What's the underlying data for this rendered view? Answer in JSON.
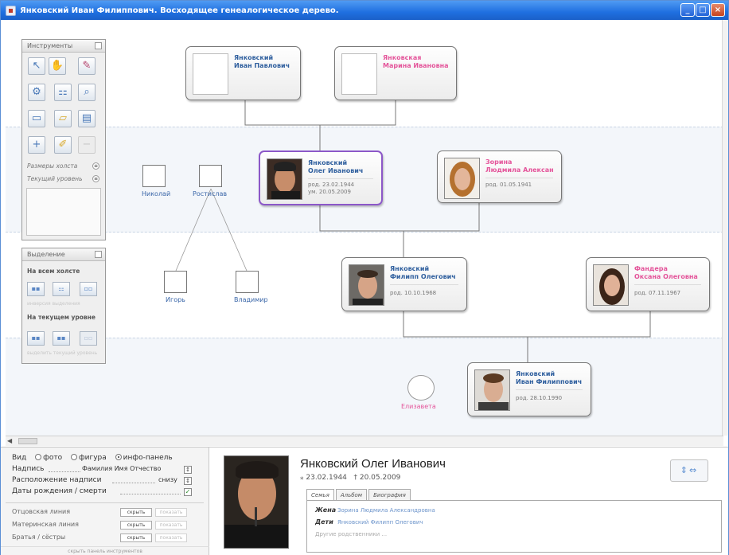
{
  "window": {
    "title": "Янковский Иван Филиппович. Восходящее генеалогическое дерево."
  },
  "tree": {
    "grandparents": [
      {
        "name1": "Янковский",
        "name2": "Иван Павлович",
        "gender": "m"
      },
      {
        "name1": "Янковская",
        "name2": "Марина Ивановна",
        "gender": "f"
      }
    ],
    "oleg": {
      "name1": "Янковский",
      "name2": "Олег Иванович",
      "birth": "род.  23.02.1944",
      "death": "ум.  20.05.2009"
    },
    "lyudmila": {
      "name1": "Зорина",
      "name2": "Людмила Алексан",
      "birth": "род.  01.05.1941"
    },
    "filipp": {
      "name1": "Янковский",
      "name2": "Филипп Олегович",
      "birth": "род.  10.10.1968"
    },
    "oksana": {
      "name1": "Фандера",
      "name2": "Оксана Олеговна",
      "birth": "род.  07.11.1967"
    },
    "ivan": {
      "name1": "Янковский",
      "name2": "Иван Филиппович",
      "birth": "род.  28.10.1990"
    },
    "small": {
      "nikolai": "Николай",
      "rostislav": "Ростислав",
      "igor": "Игорь",
      "vladimir": "Владимир",
      "elizaveta": "Елизавета"
    }
  },
  "tools_panel": {
    "title": "Инструменты",
    "canvas_size": "Размеры холста",
    "current_level": "Текущий уровень"
  },
  "selection_panel": {
    "title": "Выделение",
    "whole_canvas": "На всем холсте",
    "invert": "инверсия выделения",
    "current_level": "На текущем уровне",
    "hint": "выделить текущий уровень"
  },
  "options": {
    "view_label": "Вид",
    "view_options": [
      "фото",
      "фигура",
      "инфо-панель"
    ],
    "caption_label": "Надпись",
    "caption_value": "Фамилия Имя Отчество",
    "caption_pos_label": "Расположение надписи",
    "caption_pos_value": "снизу",
    "dates_label": "Даты рождения / смерти",
    "lines": [
      {
        "label": "Отцовская линия",
        "hide": "скрыть",
        "show": "показать"
      },
      {
        "label": "Материнская линия",
        "hide": "скрыть",
        "show": "показать"
      },
      {
        "label": "Братья / сёстры",
        "hide": "скрыть",
        "show": "показать"
      }
    ],
    "hide_panel": "скрыть панель инструментов"
  },
  "info": {
    "name": "Янковский Олег Иванович",
    "born": "⁎ 23.02.1944",
    "died": "† 20.05.2009",
    "tabs": [
      "Семья",
      "Альбом",
      "Биография"
    ],
    "wife_label": "Жена",
    "wife_value": "Зорина Людмила Александровна",
    "children_label": "Дети",
    "children_value": "Янковский Филипп Олегович",
    "other": "Другие родственники ..."
  },
  "colors": {
    "male": "#2f5f9e",
    "female": "#e4549a",
    "selected": "#8c58c8",
    "titlebar": "#1f6fe0"
  }
}
